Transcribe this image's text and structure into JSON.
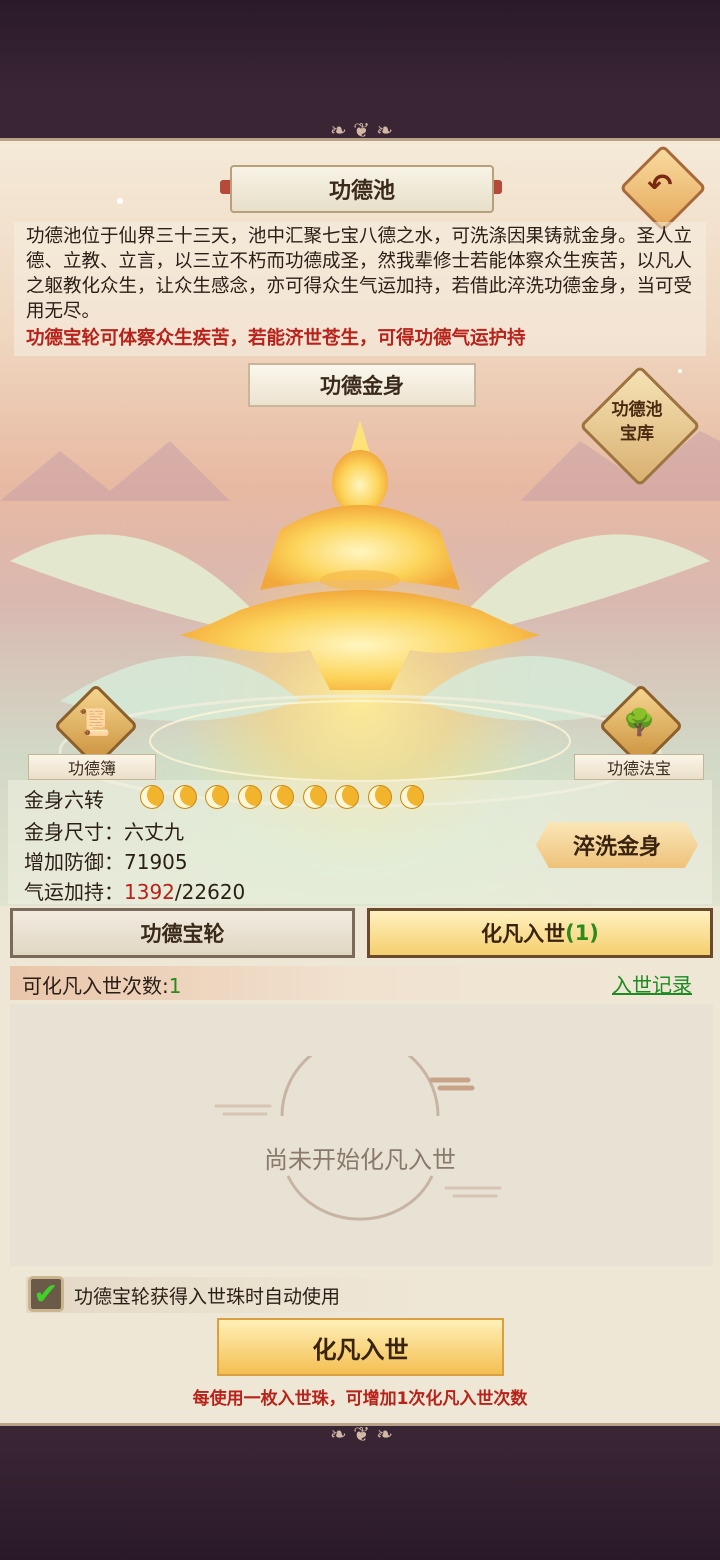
{
  "header": {
    "title": "功德池",
    "back_icon": "back-arrow-icon"
  },
  "description": {
    "text": "功德池位于仙界三十三天，池中汇聚七宝八德之水，可洗涤因果铸就金身。圣人立德、立教、立言，以三立不朽而功德成圣，然我辈修士若能体察众生疾苦，以凡人之躯教化众生，让众生感念，亦可得众生气运加持，若借此淬洗功德金身，当可受用无尽。",
    "highlight": "功德宝轮可体察众生疾苦，若能济世苍生，可得功德气运护持"
  },
  "golden_body": {
    "banner": "功德金身",
    "vault_label": "功德池宝库",
    "left_icon_label": "功德簿",
    "right_icon_label": "功德法宝"
  },
  "stats": {
    "turn_label": "金身六转",
    "moon_count": 9,
    "size_label": "金身尺寸：",
    "size_value": "六丈九",
    "defense_label": "增加防御：",
    "defense_value": "71905",
    "luck_label": "气运加持：",
    "luck_current": "1392",
    "luck_max": "/22620",
    "wash_button": "淬洗金身"
  },
  "tabs": [
    {
      "label": "功德宝轮",
      "active": false
    },
    {
      "label": "化凡入世",
      "count": "(1)",
      "active": true
    }
  ],
  "incarnate": {
    "count_label": "可化凡入世次数:",
    "count_value": "1",
    "record_link": "入世记录",
    "empty_text": "尚未开始化凡入世",
    "auto_use_label": "功德宝轮获得入世珠时自动使用",
    "auto_use_checked": true,
    "main_button": "化凡入世",
    "hint": "每使用一枚入世珠，可增加1次化凡入世次数"
  },
  "colors": {
    "accent_red": "#b8221a",
    "accent_green": "#2e8a1c",
    "gold": "#f4bf52"
  }
}
